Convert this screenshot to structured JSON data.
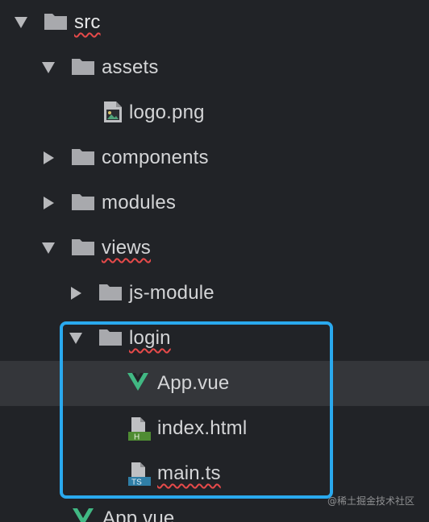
{
  "tree": {
    "src": {
      "label": "src"
    },
    "assets": {
      "label": "assets"
    },
    "logo": {
      "label": "logo.png"
    },
    "components": {
      "label": "components"
    },
    "modules": {
      "label": "modules"
    },
    "views": {
      "label": "views"
    },
    "js_module": {
      "label": "js-module"
    },
    "login": {
      "label": "login"
    },
    "login_app": {
      "label": "App.vue"
    },
    "index_html": {
      "label": "index.html",
      "badge": "H"
    },
    "main_ts": {
      "label": "main.ts",
      "badge": "TS"
    },
    "root_app": {
      "label": "App.vue"
    }
  },
  "watermark": "@稀土掘金技术社区",
  "colors": {
    "background": "#212327",
    "selected_row": "#34363a",
    "highlight_border": "#2aa9ee",
    "vue_green": "#41b883",
    "html_badge": "#4f8c33",
    "ts_badge": "#2f7ea6",
    "squiggle": "#e64a4a"
  },
  "icons": {
    "folder": "folder-icon",
    "image_file": "image-file-icon",
    "vue_file": "vue-icon",
    "html_file": "html-file-icon",
    "ts_file": "typescript-file-icon",
    "expanded": "chevron-down-icon",
    "collapsed": "chevron-right-icon"
  }
}
